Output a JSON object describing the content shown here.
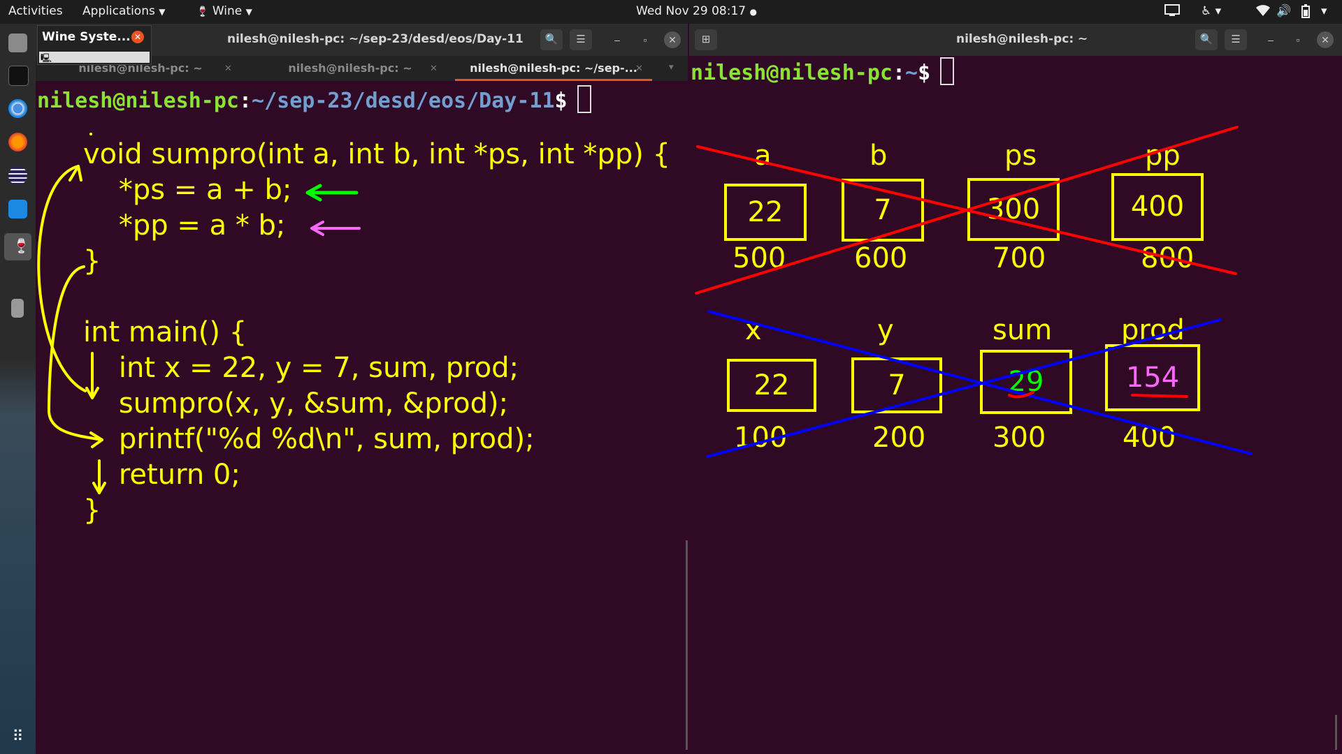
{
  "topbar": {
    "activities": "Activities",
    "applications": "Applications",
    "wine": "Wine",
    "datetime": "Wed Nov 29  08:17"
  },
  "wine_popup": {
    "title": "Wine Syste..."
  },
  "left_terminal": {
    "title": "nilesh@nilesh-pc: ~/sep-23/desd/eos/Day-11",
    "tabs": [
      "nilesh@nilesh-pc: ~",
      "nilesh@nilesh-pc: ~",
      "nilesh@nilesh-pc: ~/sep-..."
    ],
    "prompt_user": "nilesh@nilesh-pc",
    "prompt_colon": ":",
    "prompt_path": "~/sep-23/desd/eos/Day-11",
    "prompt_dollar": "$",
    "code": [
      "void sumpro(int a, int b, int *ps, int *pp) {",
      "    *ps = a + b;",
      "    *pp = a * b;",
      "}",
      "",
      "int main() {",
      "    int x = 22, y = 7, sum, prod;",
      "    sumpro(x, y, &sum, &prod);",
      "    printf(\"%d %d\\n\", sum, prod);",
      "    return 0;",
      "}"
    ]
  },
  "right_terminal": {
    "title": "nilesh@nilesh-pc: ~",
    "prompt_user": "nilesh@nilesh-pc",
    "prompt_colon": ":",
    "prompt_path": "~",
    "prompt_dollar": "$"
  },
  "diagram": {
    "sumpro_frame": {
      "names": [
        "a",
        "b",
        "ps",
        "pp"
      ],
      "values": [
        "22",
        "7",
        "300",
        "400"
      ],
      "addresses": [
        "500",
        "600",
        "700",
        "800"
      ],
      "cross_color": "#ff0000"
    },
    "main_frame": {
      "names": [
        "x",
        "y",
        "sum",
        "prod"
      ],
      "values": [
        "22",
        "7",
        "29",
        "154"
      ],
      "addresses": [
        "100",
        "200",
        "300",
        "400"
      ],
      "cross_color": "#0000ff"
    },
    "value_colors": {
      "sum": "#00ff00",
      "prod": "#ff66ff",
      "code_arrow_ps": "#00ff00",
      "code_arrow_pp": "#ff66ff"
    }
  }
}
